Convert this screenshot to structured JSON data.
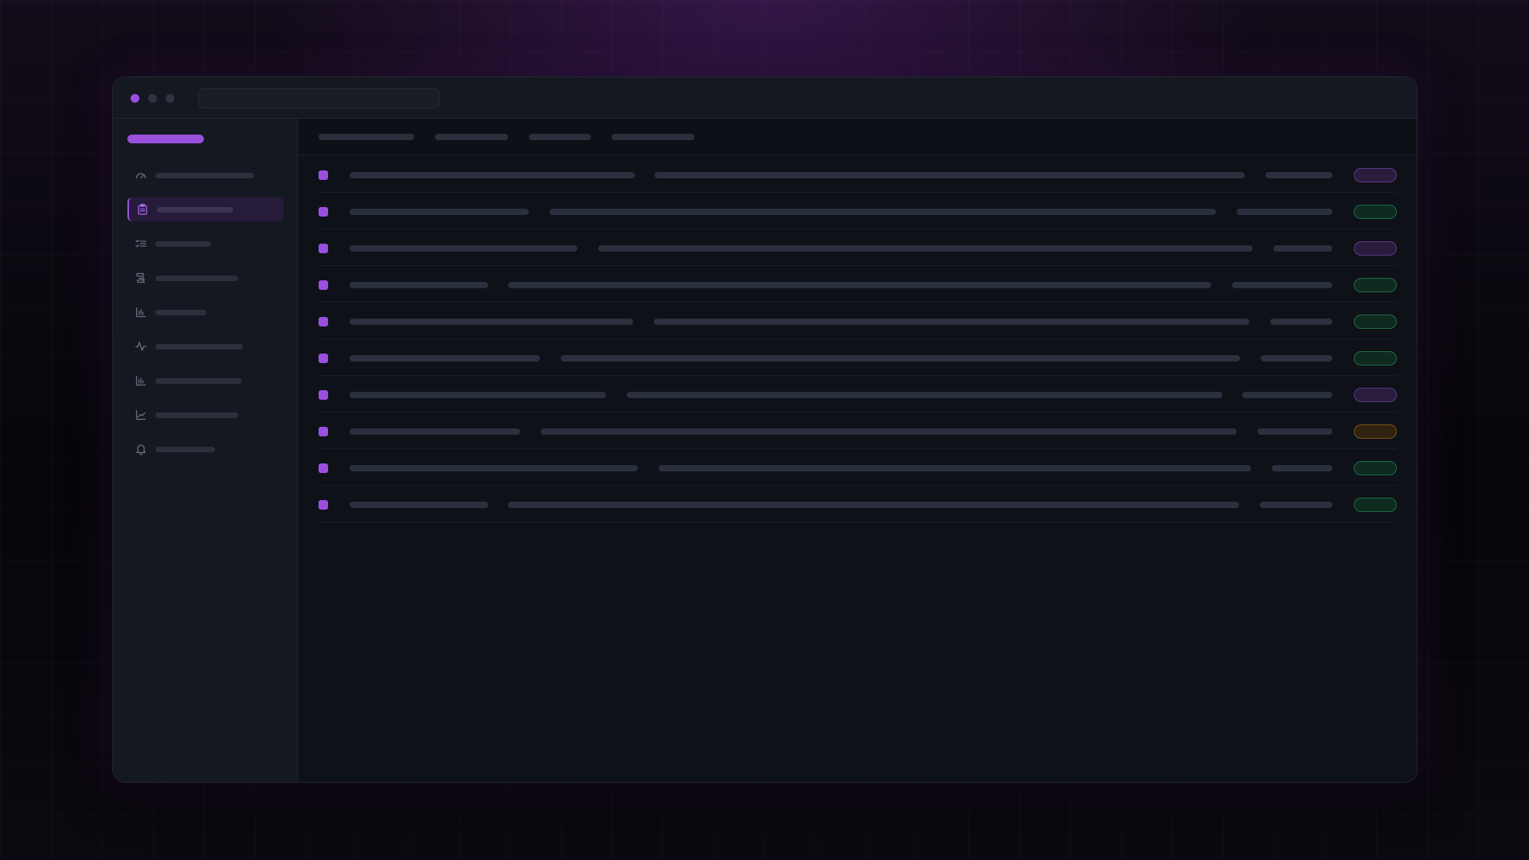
{
  "window": {
    "title": "",
    "address": "",
    "controls": [
      "close",
      "minimize",
      "maximize"
    ]
  },
  "colors": {
    "accent": "#9b4fe0",
    "status_purple": "#5b3a82",
    "status_green": "#1f6a44",
    "status_amber": "#7a5419"
  },
  "sidebar": {
    "brand": "",
    "active_index": 1,
    "items": [
      {
        "icon": "gauge-icon",
        "label": ""
      },
      {
        "icon": "clipboard-icon",
        "label": ""
      },
      {
        "icon": "checklist-icon",
        "label": ""
      },
      {
        "icon": "scroll-icon",
        "label": ""
      },
      {
        "icon": "bar-chart-icon",
        "label": ""
      },
      {
        "icon": "activity-icon",
        "label": ""
      },
      {
        "icon": "bar-chart-icon",
        "label": ""
      },
      {
        "icon": "line-chart-icon",
        "label": ""
      },
      {
        "icon": "bell-icon",
        "label": ""
      }
    ]
  },
  "tabs": [
    {
      "label": ""
    },
    {
      "label": ""
    },
    {
      "label": ""
    },
    {
      "label": ""
    }
  ],
  "rows": [
    {
      "title": "",
      "description": "",
      "meta": "",
      "status": "purple"
    },
    {
      "title": "",
      "description": "",
      "meta": "",
      "status": "green"
    },
    {
      "title": "",
      "description": "",
      "meta": "",
      "status": "purple"
    },
    {
      "title": "",
      "description": "",
      "meta": "",
      "status": "green"
    },
    {
      "title": "",
      "description": "",
      "meta": "",
      "status": "green"
    },
    {
      "title": "",
      "description": "",
      "meta": "",
      "status": "green"
    },
    {
      "title": "",
      "description": "",
      "meta": "",
      "status": "purple"
    },
    {
      "title": "",
      "description": "",
      "meta": "",
      "status": "amber"
    },
    {
      "title": "",
      "description": "",
      "meta": "",
      "status": "green"
    },
    {
      "title": "",
      "description": "",
      "meta": "",
      "status": "green"
    }
  ]
}
